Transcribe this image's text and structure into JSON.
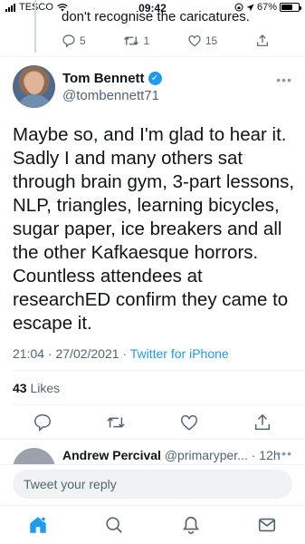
{
  "status_bar": {
    "carrier": "TESCO",
    "time": "09:42",
    "battery": "67%",
    "battery_level": 0.67
  },
  "previous_tweet": {
    "text": "don't recognise the caricatures.",
    "replies": "5",
    "retweets": "1",
    "likes": "15"
  },
  "author": {
    "name": "Tom Bennett",
    "handle": "@tombennett71"
  },
  "tweet": {
    "text": "Maybe so, and I'm glad to hear it. Sadly I and many others sat through brain gym, 3-part lessons, NLP, triangles, learning bicycles, sugar paper, ice breakers and all the other Kafkaesque horrors. Countless attendees at researchED confirm they came to escape it.",
    "timestamp": "21:04 · 27/02/2021 · ",
    "source": "Twitter for iPhone",
    "likes_count": "43",
    "likes_label": "Likes"
  },
  "reply_preview": {
    "name": "Andrew Percival",
    "handle": "@primaryper...",
    "time": "· 12h"
  },
  "reply_box": {
    "placeholder": "Tweet your reply"
  },
  "colors": {
    "accent": "#1d9bf0",
    "muted": "#536471",
    "text": "#0f1419"
  },
  "icons": [
    "wifi-icon",
    "location-icon",
    "reply-icon",
    "retweet-icon",
    "like-icon",
    "share-icon",
    "more-icon",
    "verified-icon",
    "home-icon",
    "search-icon",
    "notifications-icon",
    "messages-icon"
  ]
}
